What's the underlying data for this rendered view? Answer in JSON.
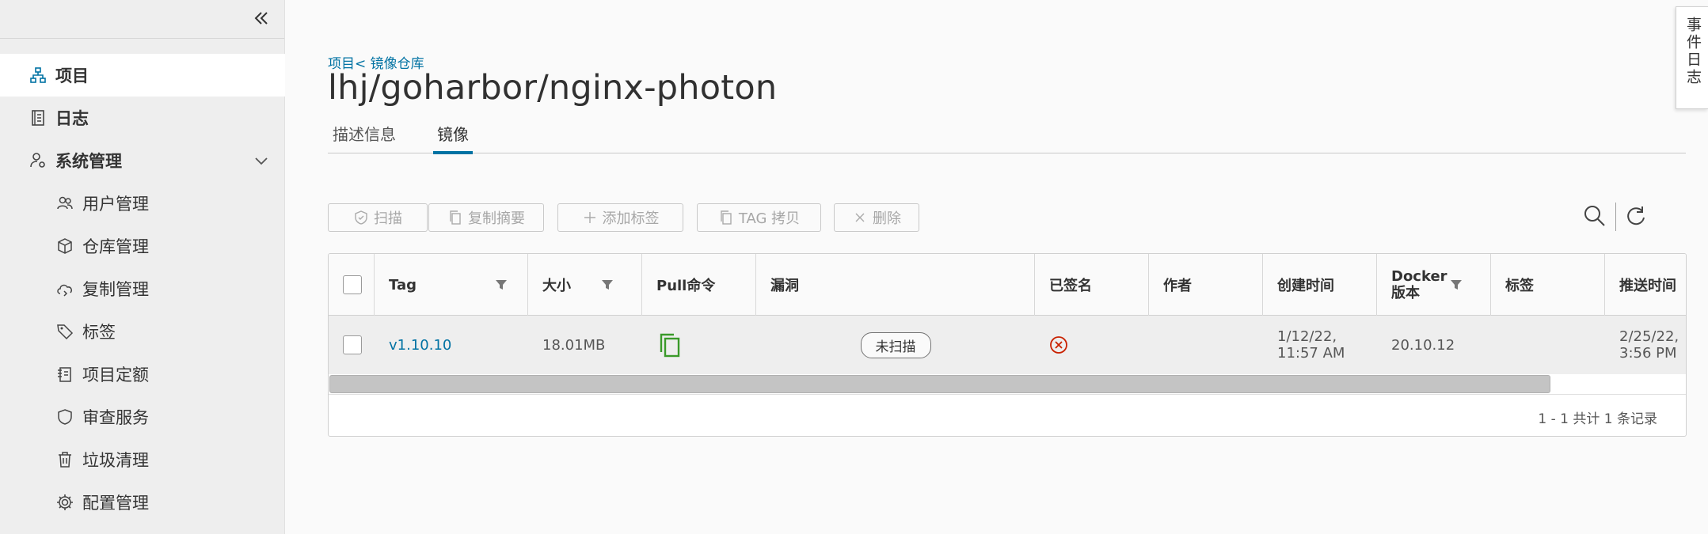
{
  "sidebar": {
    "items": [
      {
        "label": "项目",
        "icon": "project-icon"
      },
      {
        "label": "日志",
        "icon": "log-icon"
      },
      {
        "label": "系统管理",
        "icon": "admin-icon"
      },
      {
        "label": "用户管理",
        "icon": "users-icon"
      },
      {
        "label": "仓库管理",
        "icon": "box-icon"
      },
      {
        "label": "复制管理",
        "icon": "cloud-icon"
      },
      {
        "label": "标签",
        "icon": "tag-icon"
      },
      {
        "label": "项目定额",
        "icon": "quota-icon"
      },
      {
        "label": "审查服务",
        "icon": "shield-icon"
      },
      {
        "label": "垃圾清理",
        "icon": "trash-icon"
      },
      {
        "label": "配置管理",
        "icon": "gear-icon"
      }
    ]
  },
  "breadcrumb": "项目< 镜像仓库",
  "page_title": "lhj/goharbor/nginx-photon",
  "tabs": [
    {
      "label": "描述信息"
    },
    {
      "label": "镜像"
    }
  ],
  "toolbar": {
    "scan": "扫描",
    "copy_digest": "复制摘要",
    "add_label": "添加标签",
    "tag_copy": "TAG 拷贝",
    "delete": "删除"
  },
  "table": {
    "headers": {
      "tag": "Tag",
      "size": "大小",
      "pull": "Pull命令",
      "vuln": "漏洞",
      "signed": "已签名",
      "author": "作者",
      "created": "创建时间",
      "docker_line1": "Docker",
      "docker_line2": "版本",
      "labels": "标签",
      "pushed": "推送时间"
    },
    "row": {
      "tag": "v1.10.10",
      "size": "18.01MB",
      "vuln": "未扫描",
      "created_line1": "1/12/22,",
      "created_line2": "11:57 AM",
      "docker": "20.10.12",
      "pushed_line1": "2/25/22,",
      "pushed_line2": "3:56 PM"
    },
    "footer": "1 - 1 共计 1 条记录"
  },
  "event_tab": "事件日志",
  "colors": {
    "accent": "#0072a3",
    "copy_green": "#3a9a2a",
    "error_red": "#c92100"
  }
}
